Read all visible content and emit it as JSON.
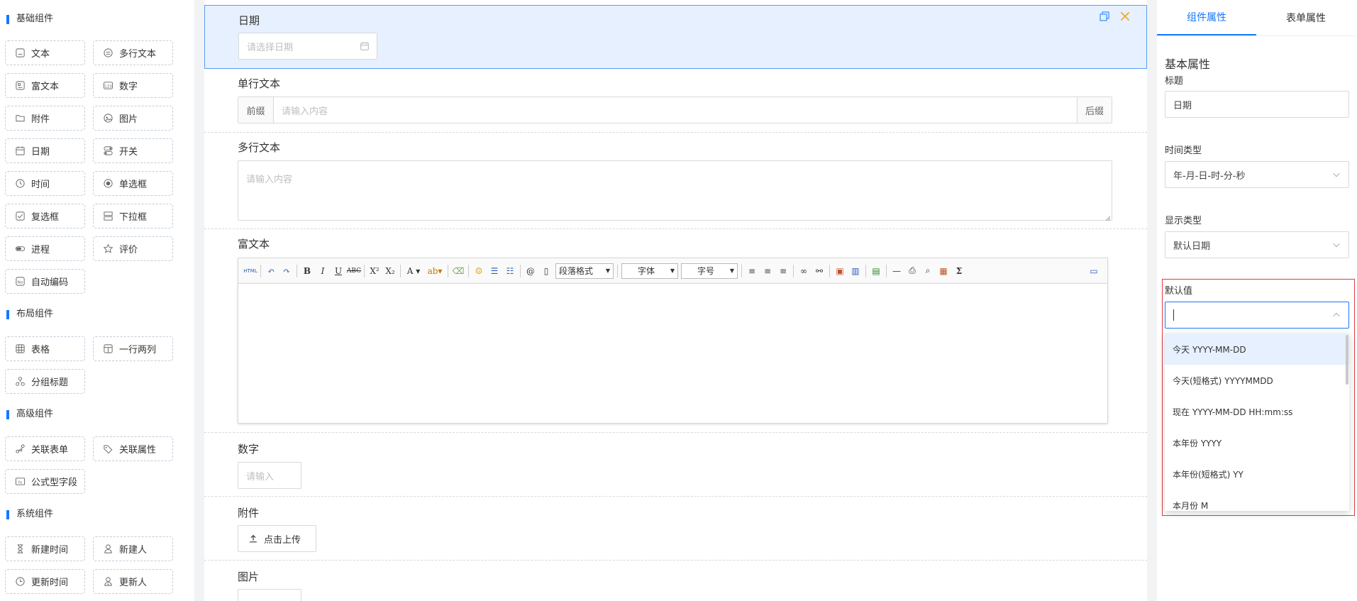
{
  "palette": {
    "sections": [
      {
        "title": "基础组件",
        "items": [
          {
            "label": "文本",
            "icon": "text-icon"
          },
          {
            "label": "多行文本",
            "icon": "textarea-icon"
          },
          {
            "label": "富文本",
            "icon": "richtext-icon"
          },
          {
            "label": "数字",
            "icon": "number-icon"
          },
          {
            "label": "附件",
            "icon": "folder-icon"
          },
          {
            "label": "图片",
            "icon": "image-icon"
          },
          {
            "label": "日期",
            "icon": "calendar-icon"
          },
          {
            "label": "开关",
            "icon": "switch-icon"
          },
          {
            "label": "时间",
            "icon": "clock-icon"
          },
          {
            "label": "单选框",
            "icon": "radio-icon"
          },
          {
            "label": "复选框",
            "icon": "checkbox-icon"
          },
          {
            "label": "下拉框",
            "icon": "select-icon"
          },
          {
            "label": "进程",
            "icon": "progress-icon"
          },
          {
            "label": "评价",
            "icon": "star-icon"
          },
          {
            "label": "自动编码",
            "icon": "autocode-icon"
          }
        ]
      },
      {
        "title": "布局组件",
        "items": [
          {
            "label": "表格",
            "icon": "table-icon"
          },
          {
            "label": "一行两列",
            "icon": "columns-icon"
          },
          {
            "label": "分组标题",
            "icon": "group-title-icon"
          }
        ]
      },
      {
        "title": "高级组件",
        "items": [
          {
            "label": "关联表单",
            "icon": "link-form-icon"
          },
          {
            "label": "关联属性",
            "icon": "tag-icon"
          },
          {
            "label": "公式型字段",
            "icon": "formula-icon"
          }
        ]
      },
      {
        "title": "系统组件",
        "items": [
          {
            "label": "新建时间",
            "icon": "hourglass-icon"
          },
          {
            "label": "新建人",
            "icon": "user-icon"
          },
          {
            "label": "更新时间",
            "icon": "clock-update-icon"
          },
          {
            "label": "更新人",
            "icon": "user-update-icon"
          }
        ]
      }
    ]
  },
  "canvas": {
    "date_field": {
      "label": "日期",
      "placeholder": "请选择日期"
    },
    "single_text": {
      "label": "单行文本",
      "prefix": "前缀",
      "placeholder": "请输入内容",
      "suffix": "后缀"
    },
    "multi_text": {
      "label": "多行文本",
      "placeholder": "请输入内容"
    },
    "rich_text": {
      "label": "富文本",
      "html_btn": "HTML",
      "paragraph": "段落格式",
      "font": "字体",
      "size": "字号"
    },
    "number": {
      "label": "数字",
      "placeholder": "请输入"
    },
    "attachment": {
      "label": "附件",
      "upload": "点击上传"
    },
    "image": {
      "label": "图片"
    }
  },
  "props": {
    "tabs": [
      "组件属性",
      "表单属性"
    ],
    "active_tab": 0,
    "basic_title": "基本属性",
    "title_label": "标题",
    "title_value": "日期",
    "time_type_label": "时间类型",
    "time_type_value": "年-月-日-时-分-秒",
    "display_type_label": "显示类型",
    "display_type_value": "默认日期",
    "default_label": "默认值",
    "default_value": "",
    "options": [
      "今天 YYYY-MM-DD",
      "今天(短格式) YYYYMMDD",
      "现在 YYYY-MM-DD HH:mm:ss",
      "本年份 YYYY",
      "本年份(短格式) YY",
      "本月份 M"
    ]
  },
  "colors": {
    "accent": "#1677ff",
    "highlight_box": "#e0393e",
    "selected_bg": "#e6f0ff"
  }
}
